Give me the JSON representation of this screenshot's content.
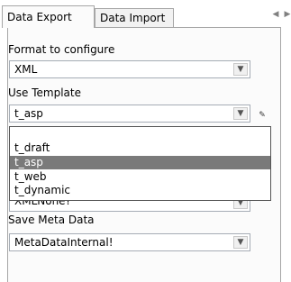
{
  "tabs": [
    {
      "label": "Data Export",
      "active": true
    },
    {
      "label": "Data Import",
      "active": false
    }
  ],
  "tab_scroll_icons": [
    "chevron-left-icon",
    "chevron-right-icon"
  ],
  "format": {
    "label": "Format to configure",
    "value": "XML"
  },
  "template": {
    "label": "Use Template",
    "value": "t_asp",
    "options": [
      "",
      "t_draft",
      "t_asp",
      "t_web",
      "t_dynamic"
    ],
    "highlighted": "t_asp"
  },
  "hidden_combo": {
    "partial_value": "XMLNone?"
  },
  "meta": {
    "label": "Save Meta Data",
    "value": "MetaDataInternal!"
  },
  "colors": {
    "selection": "#7a7a7a",
    "border": "#a6a6a6"
  }
}
